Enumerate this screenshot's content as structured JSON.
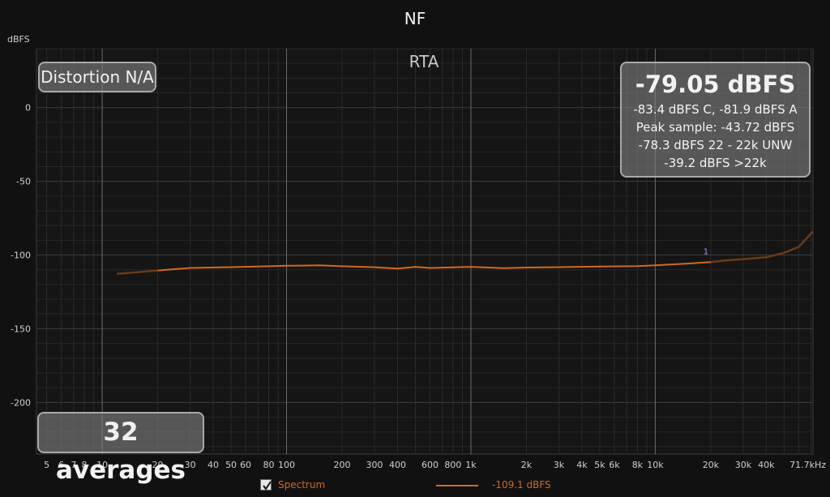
{
  "chart_data": {
    "type": "line",
    "title": "NF",
    "subtitle": "RTA",
    "ylabel": "dBFS",
    "xunit": "Hz",
    "xscale": "log",
    "xlim": [
      4.4,
      71700
    ],
    "ylim": [
      -235,
      40
    ],
    "yticks": [
      0,
      -50,
      -100,
      -150,
      -200
    ],
    "ytick_labels": [
      "0",
      "-50",
      "-100",
      "-150",
      "-200"
    ],
    "xticks": [
      5,
      6,
      7,
      8,
      10,
      20,
      30,
      40,
      50,
      60,
      80,
      100,
      200,
      300,
      400,
      600,
      800,
      1000,
      2000,
      3000,
      4000,
      5000,
      6000,
      8000,
      10000,
      20000,
      30000,
      40000,
      71700
    ],
    "xtick_labels": [
      "5",
      "6",
      "7",
      "8",
      "10",
      "20",
      "30",
      "40",
      "50",
      "60",
      "80",
      "100",
      "200",
      "300",
      "400",
      "600",
      "800",
      "1k",
      "2k",
      "3k",
      "4k",
      "5k",
      "6k",
      "8k",
      "10k",
      "20k",
      "30k",
      "40k",
      "71.7kHz"
    ],
    "grid": true,
    "series": [
      {
        "name": "Spectrum",
        "color": "#d2691e",
        "x": [
          20,
          30,
          50,
          80,
          100,
          150,
          200,
          300,
          400,
          500,
          600,
          800,
          1000,
          1500,
          2000,
          3000,
          5000,
          8000,
          10000,
          15000,
          20000
        ],
        "y": [
          -110.5,
          -108.8,
          -108.2,
          -107.6,
          -107.3,
          -107.0,
          -107.6,
          -108.3,
          -109.2,
          -108.0,
          -108.8,
          -108.4,
          -108.0,
          -108.9,
          -108.5,
          -108.2,
          -107.8,
          -107.5,
          -107.0,
          -105.8,
          -104.8
        ]
      },
      {
        "name": "",
        "color": "#6b3a14",
        "x": [
          12,
          15,
          20
        ],
        "y": [
          -112.8,
          -111.8,
          -110.5
        ]
      },
      {
        "name": "",
        "color": "#6b3a14",
        "x": [
          20000,
          25000,
          30000,
          40000,
          50000,
          60000,
          71700
        ],
        "y": [
          -104.8,
          -103.5,
          -102.8,
          -101.5,
          -98.5,
          -94.5,
          -84.0
        ]
      }
    ],
    "marker": {
      "x": 20000,
      "y": -104.8,
      "label": "1"
    }
  },
  "overlays": {
    "distortion": "Distortion N/A",
    "averages": "32 averages",
    "level": {
      "main": "-79.05 dBFS",
      "lines": [
        "-83.4 dBFS C, -81.9 dBFS A",
        "Peak sample: -43.72 dBFS",
        "-78.3 dBFS 22 - 22k UNW",
        "-39.2 dBFS >22k"
      ]
    }
  },
  "legend": {
    "checked": true,
    "name": "Spectrum",
    "value": "-109.1 dBFS",
    "color": "#d2691e"
  }
}
